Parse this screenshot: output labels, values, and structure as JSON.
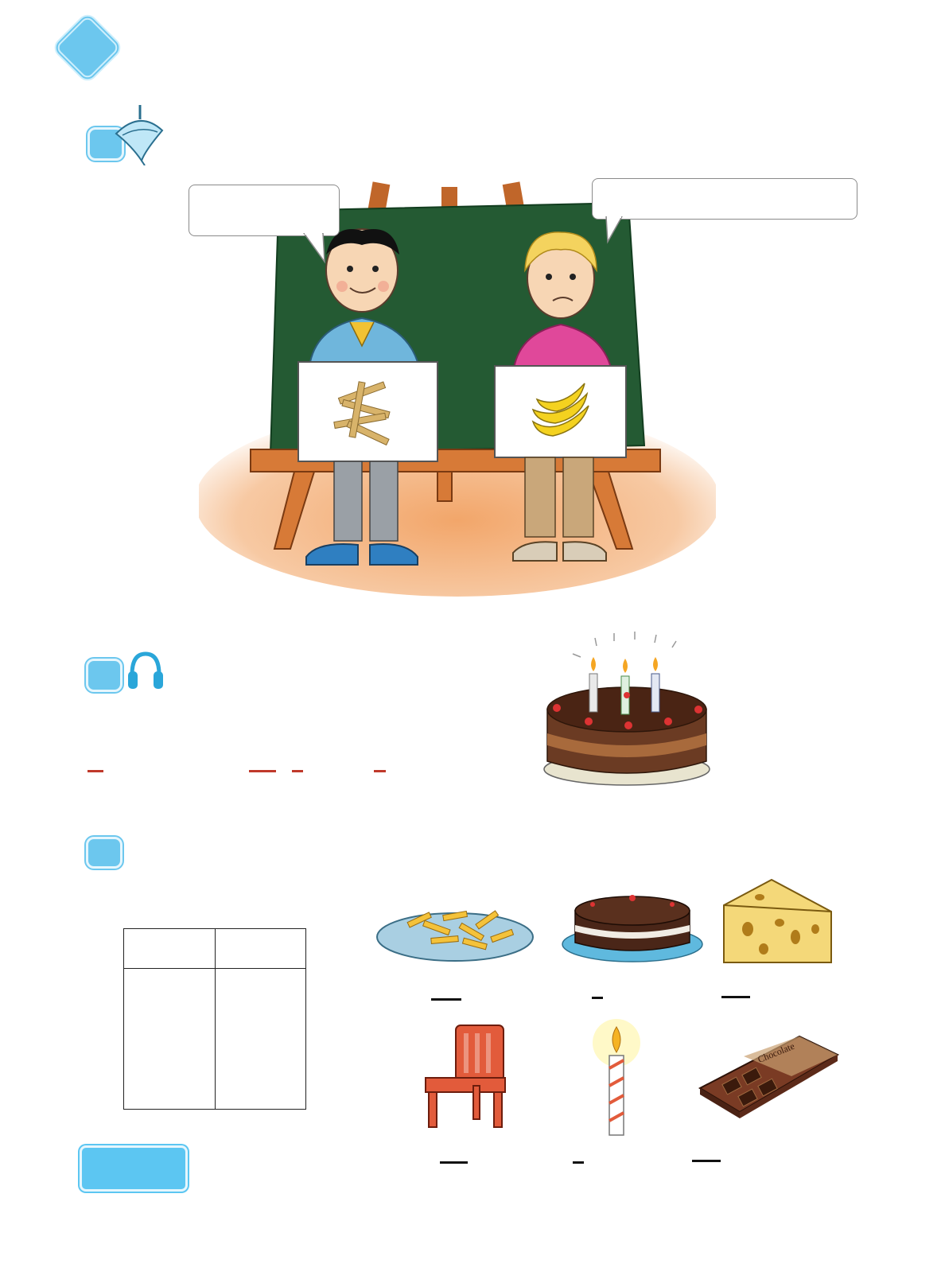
{
  "page": {
    "accent": "#6cc7ee",
    "blank_line_color": "#c0392b",
    "underline_color": "#111111"
  },
  "section_icons": {
    "diamond": "diamond-badge-icon",
    "spinning_top": "spinning-top-icon",
    "headphones": "headphones-icon",
    "footer_tab": "footer-tab-badge"
  },
  "speech_bubbles": {
    "left_text": "",
    "right_text": ""
  },
  "illustrations": [
    "boy-holding-chips-card",
    "girl-holding-bananas-card",
    "birthday-cake-with-candles",
    "plate-of-chips",
    "chocolate-cake",
    "cheese-wedge",
    "red-chair",
    "candle",
    "chocolate-bar"
  ],
  "chocolate_wrapper_text": "Chocolate",
  "sort_table": {
    "headers": [
      "",
      ""
    ],
    "rows": [
      [
        "",
        ""
      ]
    ]
  }
}
